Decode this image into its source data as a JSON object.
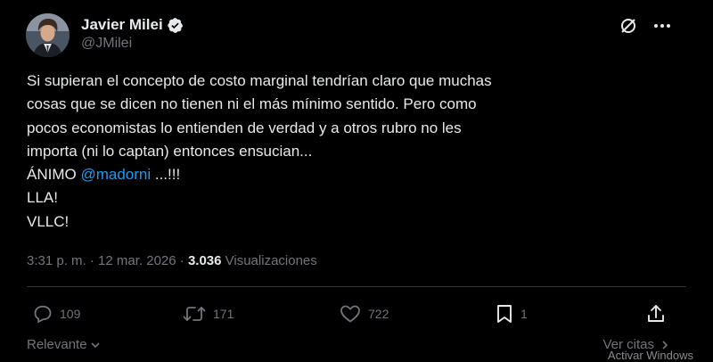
{
  "author": {
    "display_name": "Javier Milei",
    "handle": "@JMilei",
    "verified_icon": "verified-badge-icon"
  },
  "header_icons": [
    "grok-icon",
    "more-icon"
  ],
  "tweet": {
    "line1": "Si supieran el concepto de costo marginal tendrían claro que muchas",
    "line2": "cosas que se dicen no tienen ni el más mínimo sentido. Pero como",
    "line3": "pocos economistas lo entienden de verdad y a otros rubro no les",
    "line4": "importa (ni lo captan) entonces ensucian...",
    "line5_prefix": "ÁNIMO ",
    "mention": "@madorni",
    "line5_suffix": " ...!!!",
    "line6": "LLA!",
    "line7": "VLLC!"
  },
  "meta": {
    "time_date": "3:31 p. m. · 12 mar. 2026 · ",
    "views_count": "3.036",
    "views_label": " Visualizaciones"
  },
  "actions": {
    "replies": "109",
    "reposts": "171",
    "likes": "722",
    "bookmarks": "1"
  },
  "footer": {
    "sort_label": "Relevante",
    "quotes_label": "Ver citas"
  },
  "watermark": "Activar Windows",
  "colors": {
    "background": "#000000",
    "text": "#e7e9ea",
    "secondary": "#71767b",
    "accent": "#1d9bf0"
  }
}
